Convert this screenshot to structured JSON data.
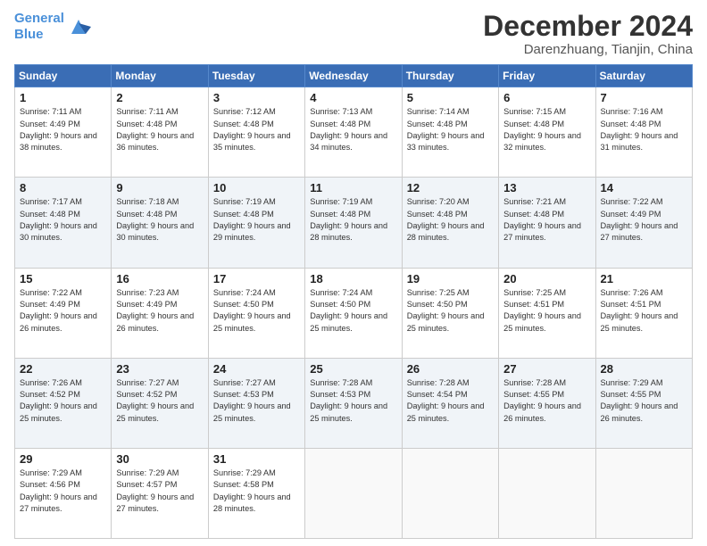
{
  "header": {
    "logo_line1": "General",
    "logo_line2": "Blue",
    "title": "December 2024",
    "location": "Darenzhuang, Tianjin, China"
  },
  "days_of_week": [
    "Sunday",
    "Monday",
    "Tuesday",
    "Wednesday",
    "Thursday",
    "Friday",
    "Saturday"
  ],
  "weeks": [
    [
      {
        "day": "1",
        "sunrise": "Sunrise: 7:11 AM",
        "sunset": "Sunset: 4:49 PM",
        "daylight": "Daylight: 9 hours and 38 minutes."
      },
      {
        "day": "2",
        "sunrise": "Sunrise: 7:11 AM",
        "sunset": "Sunset: 4:48 PM",
        "daylight": "Daylight: 9 hours and 36 minutes."
      },
      {
        "day": "3",
        "sunrise": "Sunrise: 7:12 AM",
        "sunset": "Sunset: 4:48 PM",
        "daylight": "Daylight: 9 hours and 35 minutes."
      },
      {
        "day": "4",
        "sunrise": "Sunrise: 7:13 AM",
        "sunset": "Sunset: 4:48 PM",
        "daylight": "Daylight: 9 hours and 34 minutes."
      },
      {
        "day": "5",
        "sunrise": "Sunrise: 7:14 AM",
        "sunset": "Sunset: 4:48 PM",
        "daylight": "Daylight: 9 hours and 33 minutes."
      },
      {
        "day": "6",
        "sunrise": "Sunrise: 7:15 AM",
        "sunset": "Sunset: 4:48 PM",
        "daylight": "Daylight: 9 hours and 32 minutes."
      },
      {
        "day": "7",
        "sunrise": "Sunrise: 7:16 AM",
        "sunset": "Sunset: 4:48 PM",
        "daylight": "Daylight: 9 hours and 31 minutes."
      }
    ],
    [
      {
        "day": "8",
        "sunrise": "Sunrise: 7:17 AM",
        "sunset": "Sunset: 4:48 PM",
        "daylight": "Daylight: 9 hours and 30 minutes."
      },
      {
        "day": "9",
        "sunrise": "Sunrise: 7:18 AM",
        "sunset": "Sunset: 4:48 PM",
        "daylight": "Daylight: 9 hours and 30 minutes."
      },
      {
        "day": "10",
        "sunrise": "Sunrise: 7:19 AM",
        "sunset": "Sunset: 4:48 PM",
        "daylight": "Daylight: 9 hours and 29 minutes."
      },
      {
        "day": "11",
        "sunrise": "Sunrise: 7:19 AM",
        "sunset": "Sunset: 4:48 PM",
        "daylight": "Daylight: 9 hours and 28 minutes."
      },
      {
        "day": "12",
        "sunrise": "Sunrise: 7:20 AM",
        "sunset": "Sunset: 4:48 PM",
        "daylight": "Daylight: 9 hours and 28 minutes."
      },
      {
        "day": "13",
        "sunrise": "Sunrise: 7:21 AM",
        "sunset": "Sunset: 4:48 PM",
        "daylight": "Daylight: 9 hours and 27 minutes."
      },
      {
        "day": "14",
        "sunrise": "Sunrise: 7:22 AM",
        "sunset": "Sunset: 4:49 PM",
        "daylight": "Daylight: 9 hours and 27 minutes."
      }
    ],
    [
      {
        "day": "15",
        "sunrise": "Sunrise: 7:22 AM",
        "sunset": "Sunset: 4:49 PM",
        "daylight": "Daylight: 9 hours and 26 minutes."
      },
      {
        "day": "16",
        "sunrise": "Sunrise: 7:23 AM",
        "sunset": "Sunset: 4:49 PM",
        "daylight": "Daylight: 9 hours and 26 minutes."
      },
      {
        "day": "17",
        "sunrise": "Sunrise: 7:24 AM",
        "sunset": "Sunset: 4:50 PM",
        "daylight": "Daylight: 9 hours and 25 minutes."
      },
      {
        "day": "18",
        "sunrise": "Sunrise: 7:24 AM",
        "sunset": "Sunset: 4:50 PM",
        "daylight": "Daylight: 9 hours and 25 minutes."
      },
      {
        "day": "19",
        "sunrise": "Sunrise: 7:25 AM",
        "sunset": "Sunset: 4:50 PM",
        "daylight": "Daylight: 9 hours and 25 minutes."
      },
      {
        "day": "20",
        "sunrise": "Sunrise: 7:25 AM",
        "sunset": "Sunset: 4:51 PM",
        "daylight": "Daylight: 9 hours and 25 minutes."
      },
      {
        "day": "21",
        "sunrise": "Sunrise: 7:26 AM",
        "sunset": "Sunset: 4:51 PM",
        "daylight": "Daylight: 9 hours and 25 minutes."
      }
    ],
    [
      {
        "day": "22",
        "sunrise": "Sunrise: 7:26 AM",
        "sunset": "Sunset: 4:52 PM",
        "daylight": "Daylight: 9 hours and 25 minutes."
      },
      {
        "day": "23",
        "sunrise": "Sunrise: 7:27 AM",
        "sunset": "Sunset: 4:52 PM",
        "daylight": "Daylight: 9 hours and 25 minutes."
      },
      {
        "day": "24",
        "sunrise": "Sunrise: 7:27 AM",
        "sunset": "Sunset: 4:53 PM",
        "daylight": "Daylight: 9 hours and 25 minutes."
      },
      {
        "day": "25",
        "sunrise": "Sunrise: 7:28 AM",
        "sunset": "Sunset: 4:53 PM",
        "daylight": "Daylight: 9 hours and 25 minutes."
      },
      {
        "day": "26",
        "sunrise": "Sunrise: 7:28 AM",
        "sunset": "Sunset: 4:54 PM",
        "daylight": "Daylight: 9 hours and 25 minutes."
      },
      {
        "day": "27",
        "sunrise": "Sunrise: 7:28 AM",
        "sunset": "Sunset: 4:55 PM",
        "daylight": "Daylight: 9 hours and 26 minutes."
      },
      {
        "day": "28",
        "sunrise": "Sunrise: 7:29 AM",
        "sunset": "Sunset: 4:55 PM",
        "daylight": "Daylight: 9 hours and 26 minutes."
      }
    ],
    [
      {
        "day": "29",
        "sunrise": "Sunrise: 7:29 AM",
        "sunset": "Sunset: 4:56 PM",
        "daylight": "Daylight: 9 hours and 27 minutes."
      },
      {
        "day": "30",
        "sunrise": "Sunrise: 7:29 AM",
        "sunset": "Sunset: 4:57 PM",
        "daylight": "Daylight: 9 hours and 27 minutes."
      },
      {
        "day": "31",
        "sunrise": "Sunrise: 7:29 AM",
        "sunset": "Sunset: 4:58 PM",
        "daylight": "Daylight: 9 hours and 28 minutes."
      },
      null,
      null,
      null,
      null
    ]
  ]
}
